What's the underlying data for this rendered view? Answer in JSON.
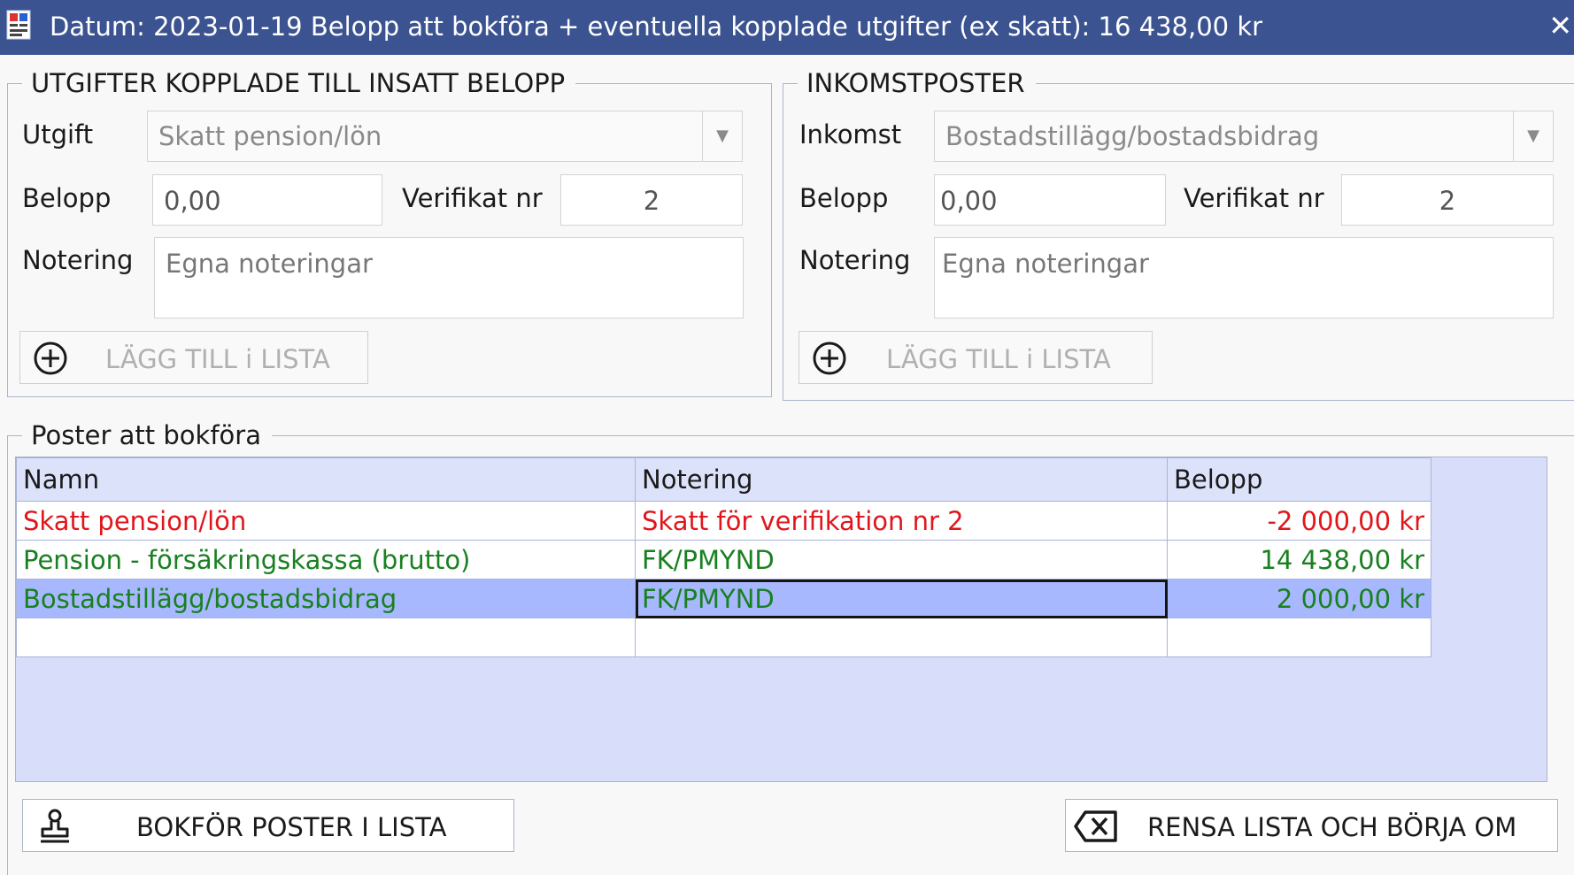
{
  "window": {
    "title": "Datum: 2023-01-19 Belopp att bokföra + eventuella kopplade utgifter (ex skatt): 16 438,00 kr",
    "close_glyph": "✕"
  },
  "expenses": {
    "legend": "UTGIFTER KOPPLADE TILL INSATT BELOPP",
    "type_label": "Utgift",
    "type_value": "Skatt pension/lön",
    "amount_label": "Belopp",
    "amount_value": "0,00",
    "voucher_label": "Verifikat nr",
    "voucher_value": "2",
    "note_label": "Notering",
    "note_placeholder": "Egna noteringar",
    "add_button": "LÄGG TILL i LISTA"
  },
  "income": {
    "legend": "INKOMSTPOSTER",
    "type_label": "Inkomst",
    "type_value": "Bostadstillägg/bostadsbidrag",
    "amount_label": "Belopp",
    "amount_value": "0,00",
    "voucher_label": "Verifikat nr",
    "voucher_value": "2",
    "note_label": "Notering",
    "note_placeholder": "Egna noteringar",
    "add_button": "LÄGG TILL i LISTA"
  },
  "postings": {
    "legend": "Poster att bokföra",
    "columns": [
      "Namn",
      "Notering",
      "Belopp"
    ],
    "rows": [
      {
        "name": "Skatt pension/lön",
        "note": "Skatt för verifikation nr 2",
        "amount": "-2 000,00 kr",
        "kind": "expense"
      },
      {
        "name": "Pension - försäkringskassa (brutto)",
        "note": "FK/PMYND",
        "amount": "14 438,00 kr",
        "kind": "income"
      },
      {
        "name": "Bostadstillägg/bostadsbidrag",
        "note": "FK/PMYND",
        "amount": "2 000,00 kr",
        "kind": "income",
        "selected": true
      }
    ]
  },
  "actions": {
    "book_button": "BOKFÖR POSTER I LISTA",
    "clear_button": "RENSA LISTA OCH BÖRJA OM"
  },
  "colors": {
    "titlebar": "#3b5390",
    "expense_text": "#e0161b",
    "income_text": "#198020",
    "selected_row": "#a8b8ff",
    "grid_background": "#d8defa"
  }
}
